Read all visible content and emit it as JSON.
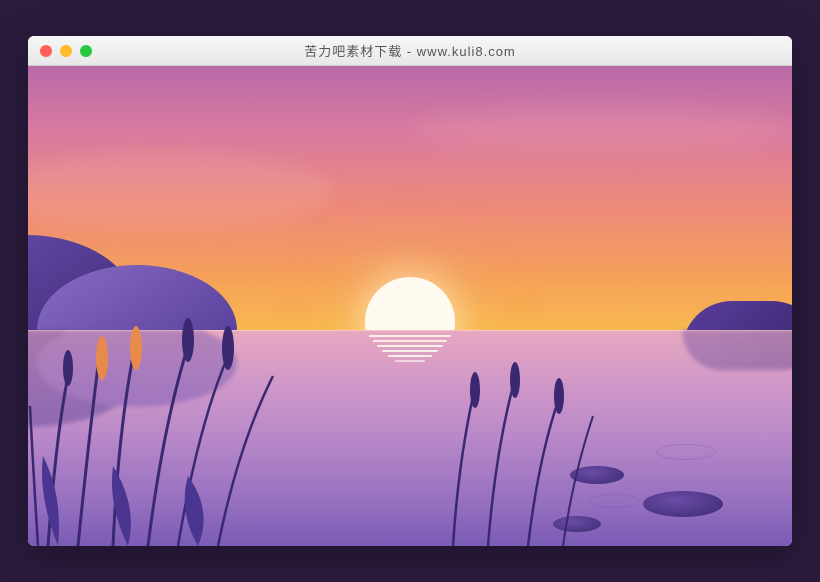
{
  "window": {
    "title": "苦力吧素材下载 - www.kuli8.com"
  }
}
